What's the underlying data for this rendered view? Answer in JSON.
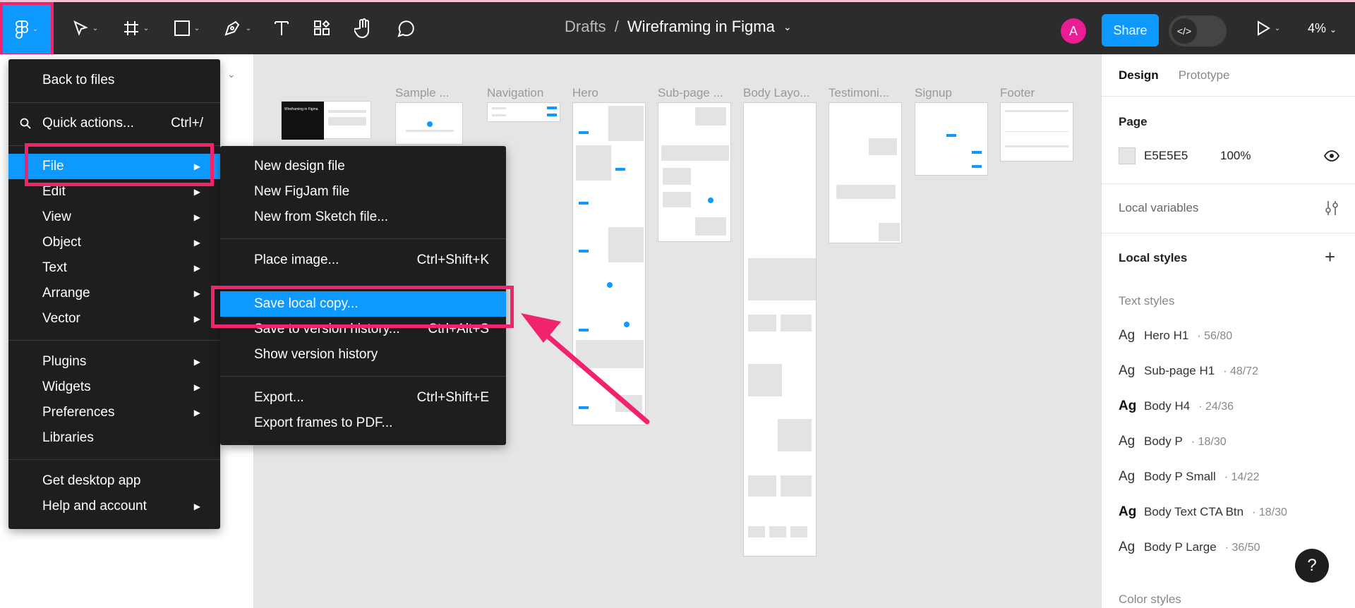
{
  "toolbar": {
    "breadcrumb": {
      "folder": "Drafts",
      "separator": "/",
      "title": "Wireframing in Figma"
    },
    "avatar_letter": "A",
    "share_label": "Share",
    "devmode_icon": "</>",
    "zoom": "4%",
    "icons": [
      "figma-icon",
      "move-icon",
      "frame-icon",
      "shape-icon",
      "pen-icon",
      "text-icon",
      "resources-icon",
      "hand-icon",
      "comment-icon",
      "play-icon"
    ]
  },
  "main_menu": {
    "back": "Back to files",
    "quick_actions": {
      "label": "Quick actions...",
      "shortcut": "Ctrl+/"
    },
    "items": [
      {
        "label": "File",
        "sub": true
      },
      {
        "label": "Edit",
        "sub": true
      },
      {
        "label": "View",
        "sub": true
      },
      {
        "label": "Object",
        "sub": true
      },
      {
        "label": "Text",
        "sub": true
      },
      {
        "label": "Arrange",
        "sub": true
      },
      {
        "label": "Vector",
        "sub": true
      }
    ],
    "group2": [
      {
        "label": "Plugins",
        "sub": true
      },
      {
        "label": "Widgets",
        "sub": true
      },
      {
        "label": "Preferences",
        "sub": true
      },
      {
        "label": "Libraries",
        "sub": false
      }
    ],
    "group3": [
      {
        "label": "Get desktop app",
        "sub": false
      },
      {
        "label": "Help and account",
        "sub": true
      }
    ]
  },
  "file_menu": {
    "group1": [
      {
        "label": "New design file",
        "shortcut": ""
      },
      {
        "label": "New FigJam file",
        "shortcut": ""
      },
      {
        "label": "New from Sketch file...",
        "shortcut": ""
      }
    ],
    "group2": [
      {
        "label": "Place image...",
        "shortcut": "Ctrl+Shift+K"
      },
      {
        "label": "Save local copy...",
        "shortcut": ""
      },
      {
        "label": "Save to version history...",
        "shortcut": "Ctrl+Alt+S"
      },
      {
        "label": "Show version history",
        "shortcut": ""
      }
    ],
    "group3": [
      {
        "label": "Export...",
        "shortcut": "Ctrl+Shift+E"
      },
      {
        "label": "Export frames to PDF...",
        "shortcut": ""
      }
    ]
  },
  "canvas": {
    "frames": [
      "Sample ...",
      "Navigation",
      "Hero",
      "Sub-page ...",
      "Body Layo...",
      "Testimoni...",
      "Signup",
      "Footer"
    ],
    "cover_title": "Wireframing in Figma"
  },
  "right_panel": {
    "tabs": [
      "Design",
      "Prototype"
    ],
    "page_title": "Page",
    "page_color": "E5E5E5",
    "page_opacity": "100%",
    "local_variables": "Local variables",
    "local_styles": "Local styles",
    "text_styles_title": "Text styles",
    "text_styles": [
      {
        "ag": "Ag",
        "name": "Hero H1",
        "meta": "· 56/80",
        "bold": false
      },
      {
        "ag": "Ag",
        "name": "Sub-page H1",
        "meta": "· 48/72",
        "bold": false
      },
      {
        "ag": "Ag",
        "name": "Body H4",
        "meta": "· 24/36",
        "bold": true
      },
      {
        "ag": "Ag",
        "name": "Body P",
        "meta": "· 18/30",
        "bold": false
      },
      {
        "ag": "Ag",
        "name": "Body P Small",
        "meta": "· 14/22",
        "bold": false
      },
      {
        "ag": "Ag",
        "name": "Body Text CTA Btn",
        "meta": "· 18/30",
        "bold": true
      },
      {
        "ag": "Ag",
        "name": "Body P Large",
        "meta": "· 36/50",
        "bold": false
      }
    ],
    "color_styles_title": "Color styles",
    "help_label": "?"
  },
  "colors": {
    "accent": "#0d99ff",
    "annotation": "#f2236e",
    "toolbar": "#2c2c2c",
    "menu": "#1e1e1e"
  }
}
